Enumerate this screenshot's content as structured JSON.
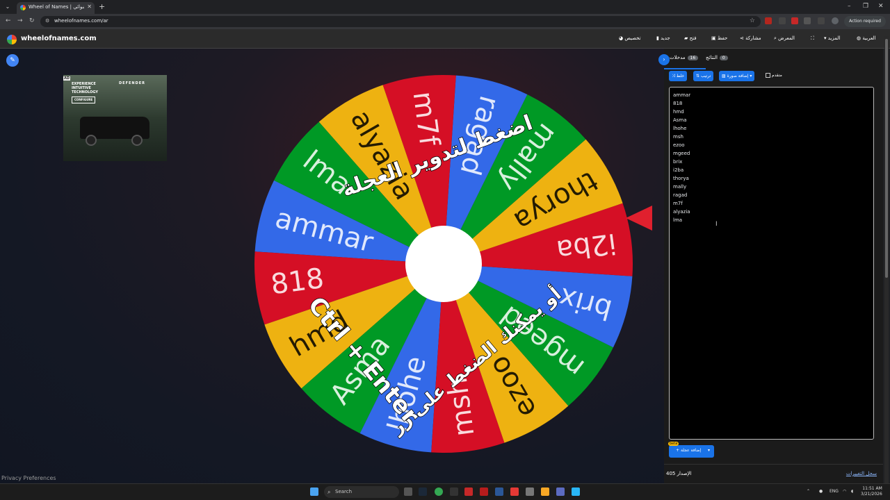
{
  "browser": {
    "tab_title": "Wheel of Names | دولاب العشوائي",
    "url": "wheelofnames.com/ar",
    "action_required": "Action required"
  },
  "site": {
    "brand": "wheelofnames.com",
    "nav": {
      "customize": "تخصيص",
      "new": "جديد",
      "open": "فتح",
      "save": "حفظ",
      "share": "مشاركة",
      "gallery": "المعرض",
      "more": "المزيد",
      "language": "العربية"
    },
    "privacy": "Privacy Preferences"
  },
  "ad": {
    "headline_1": "EXPERIENCE",
    "headline_2": "INTUITIVE",
    "headline_3": "TECHNOLOGY",
    "brand": "DEFENDER",
    "cta": "CONFIGURE",
    "ad_label": "AD"
  },
  "wheel": {
    "entries": [
      "ammar",
      "818",
      "hmd",
      "Asma",
      "lhohe",
      "msh",
      "ezoo",
      "mgeed",
      "brix",
      "i2ba",
      "thorya",
      "mally",
      "ragad",
      "m7f",
      "alyazia",
      "lma"
    ],
    "colors": [
      "#3369e8",
      "#d50f25",
      "#eeb211",
      "#009925"
    ],
    "overlay_top": "اضغط لتدوير العجلة",
    "overlay_mid": "أو يمكنك الضغط على زر",
    "overlay_keys": "Ctrl + Enter"
  },
  "panel": {
    "entries_tab": "مدخلات",
    "entries_count": "16",
    "results_tab": "النتائج",
    "results_count": "0",
    "shuffle": "خلط",
    "sort": "ترتيب",
    "add_image": "إضافة صورة",
    "advanced": "متقدم",
    "add_entry_image": "إضافة عجلة",
    "beta": "beta",
    "version_label": "الإصدار",
    "version": "405",
    "changelog": "سجل التغييرات"
  },
  "taskbar": {
    "search": "Search",
    "lang": "ENG",
    "time": "11:51 AM",
    "date": "3/21/2026"
  }
}
